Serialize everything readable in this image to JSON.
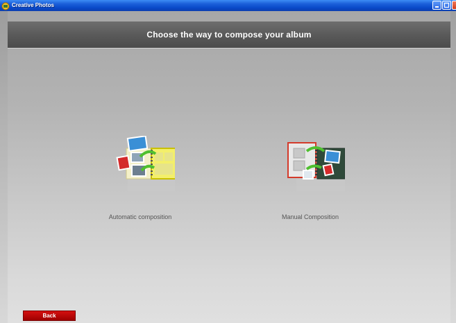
{
  "window": {
    "title": "Creative Photos",
    "icon": "app-icon",
    "controls": [
      "minimize-icon",
      "maximize-icon",
      "close-icon"
    ]
  },
  "header": {
    "title": "Choose the way to compose your album"
  },
  "options": [
    {
      "label": "Automatic composition",
      "icon": "automatic-composition-icon"
    },
    {
      "label": "Manual Composition",
      "icon": "manual-composition-icon"
    }
  ],
  "footer": {
    "back_label": "Back"
  },
  "colors": {
    "titlebar": "#0a49c9",
    "header_bg": "#5a5a5a",
    "back_button": "#c00000",
    "label_text": "#555555"
  }
}
